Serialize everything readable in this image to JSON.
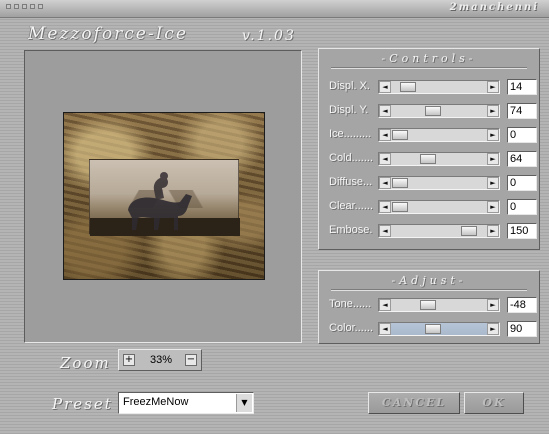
{
  "header": {
    "brand": "2manchenni",
    "title": "Mezzoforce-Ice",
    "version": "v.1.03"
  },
  "controls": {
    "title": "-Controls-",
    "rows": [
      {
        "label": "Displ. X.",
        "value": "14",
        "level": 0.1
      },
      {
        "label": "Displ. Y.",
        "value": "74",
        "level": 0.42
      },
      {
        "label": "Ice.........",
        "value": "0",
        "level": 0.0
      },
      {
        "label": "Cold.......",
        "value": "64",
        "level": 0.36
      },
      {
        "label": "Diffuse...",
        "value": "0",
        "level": 0.0
      },
      {
        "label": "Clear......",
        "value": "0",
        "level": 0.0
      },
      {
        "label": "Embose.",
        "value": "150",
        "level": 0.88
      }
    ]
  },
  "adjust": {
    "title": "-Adjust-",
    "rows": [
      {
        "label": "Tone......",
        "value": "-48",
        "level": 0.36
      },
      {
        "label": "Color......",
        "value": "90",
        "level": 0.42
      }
    ]
  },
  "zoom": {
    "label": "Zoom",
    "value": "33%",
    "plus_icon": "plus-icon",
    "minus_icon": "minus-icon"
  },
  "preset": {
    "label": "Preset",
    "selected": "FreezMeNow"
  },
  "buttons": {
    "cancel": "CANCEL",
    "ok": "OK"
  },
  "colors": {
    "background": "#a9a9a9",
    "panel": "#a5a5a5",
    "color_track": "#b0bfd2"
  }
}
